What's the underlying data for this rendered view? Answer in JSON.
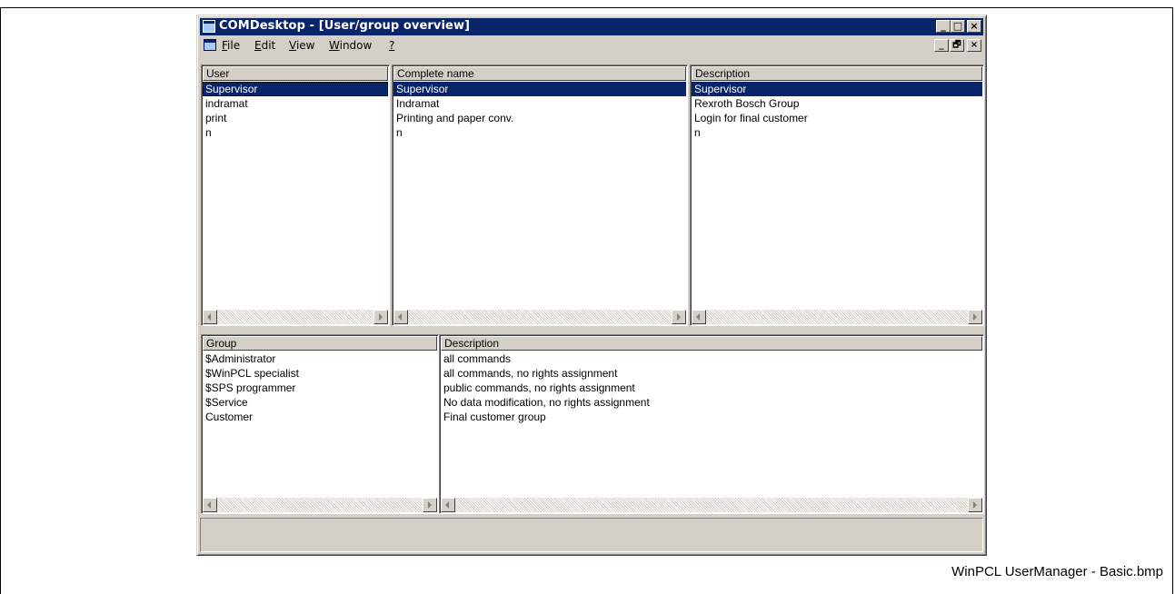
{
  "caption": "WinPCL UserManager - Basic.bmp",
  "window": {
    "title": "COMDesktop - [User/group overview]",
    "caption_buttons": [
      "_",
      "□",
      "×"
    ],
    "mdi_buttons": [
      "_",
      "🗗",
      "×"
    ]
  },
  "menu": {
    "items": [
      {
        "label": "File",
        "mnemonic": "F"
      },
      {
        "label": "Edit",
        "mnemonic": "E"
      },
      {
        "label": "View",
        "mnemonic": "V"
      },
      {
        "label": "Window",
        "mnemonic": "W"
      },
      {
        "label": "?",
        "mnemonic": "?"
      }
    ]
  },
  "users": {
    "columns": [
      "User",
      "Complete name",
      "Description"
    ],
    "rows": [
      {
        "user": "Supervisor",
        "name": "Supervisor",
        "description": "Supervisor",
        "selected": true
      },
      {
        "user": "indramat",
        "name": "Indramat",
        "description": "Rexroth Bosch Group",
        "selected": false
      },
      {
        "user": "print",
        "name": "Printing and paper conv.",
        "description": "Login for final customer",
        "selected": false
      },
      {
        "user": "n",
        "name": "n",
        "description": "n",
        "selected": false
      }
    ]
  },
  "groups": {
    "columns": [
      "Group",
      "Description"
    ],
    "rows": [
      {
        "group": "$Administrator",
        "description": "all commands"
      },
      {
        "group": "$WinPCL specialist",
        "description": "all commands, no rights assignment"
      },
      {
        "group": "$SPS programmer",
        "description": "public commands, no rights assignment"
      },
      {
        "group": "$Service",
        "description": "No data modification, no rights assignment"
      },
      {
        "group": "Customer",
        "description": "Final customer group"
      }
    ]
  },
  "colors": {
    "titlebar": "#0a246a",
    "selection": "#0a246a",
    "face": "#d4d0c8"
  },
  "icons": {
    "app": "app-window-icon",
    "doc": "mdi-document-icon",
    "scroll_left": "scroll-left-arrow-icon",
    "scroll_right": "scroll-right-arrow-icon"
  }
}
